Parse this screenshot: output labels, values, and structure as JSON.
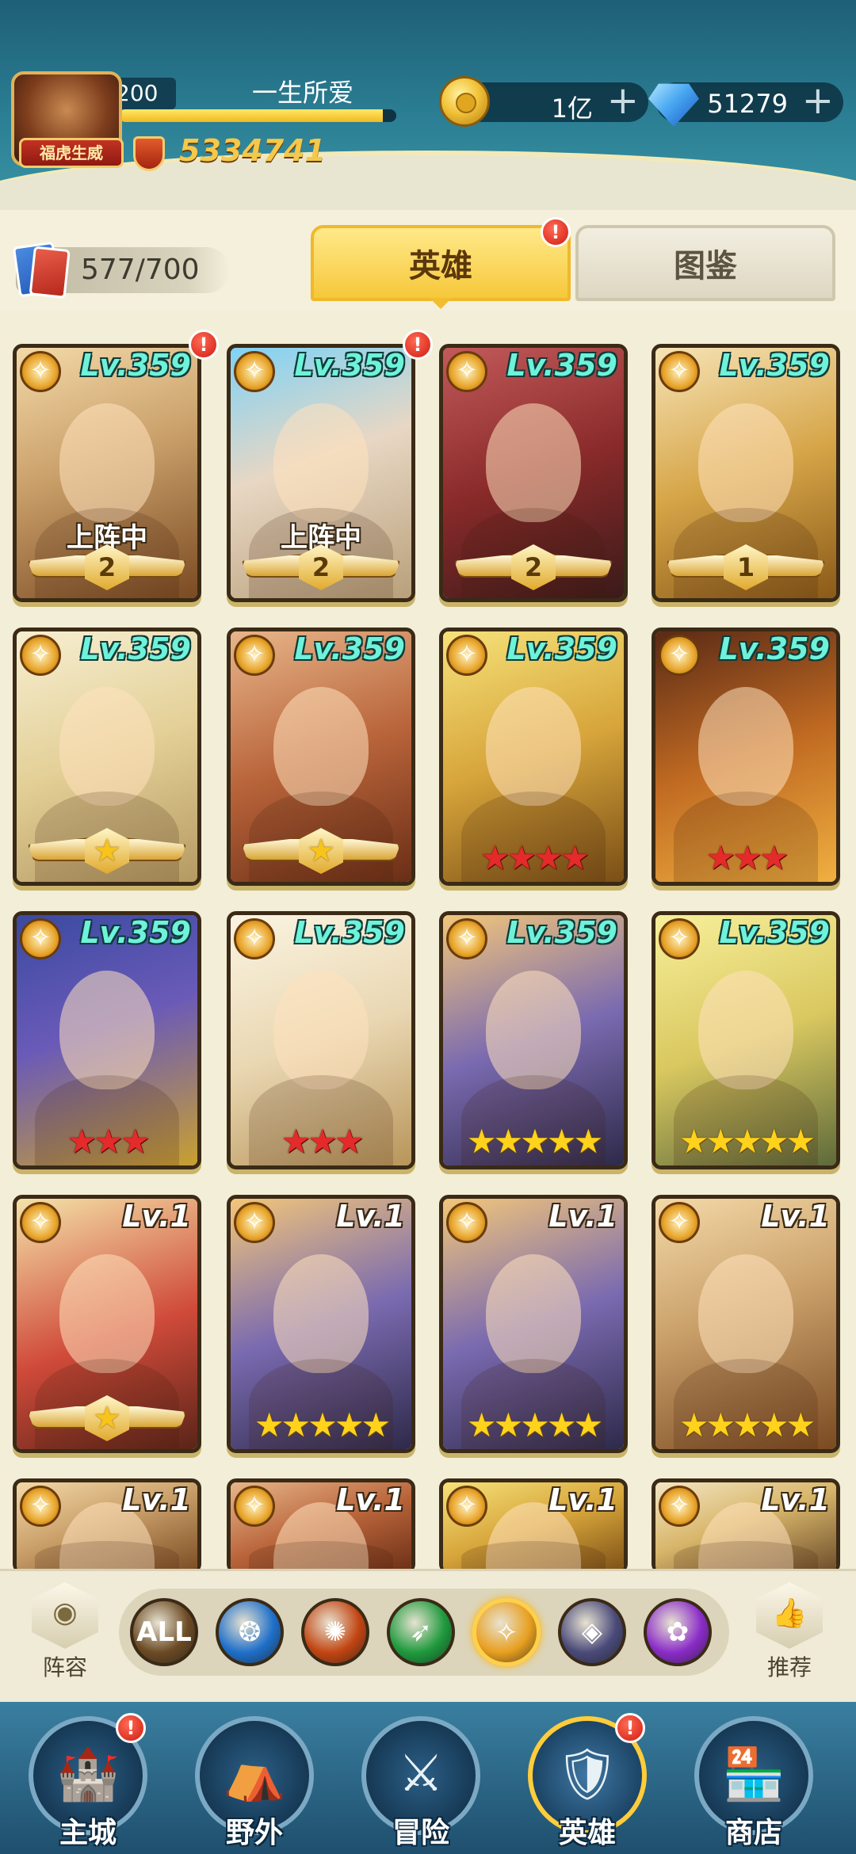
{
  "header": {
    "avatar_badge": "福虎生威",
    "player_level": "200",
    "player_name": "一生所爱",
    "xp_fraction": 0.95,
    "power": "5334741",
    "coins": "1亿",
    "gems": "51279",
    "plus_symbol": "+"
  },
  "collection": {
    "count": "577/700"
  },
  "tabs": [
    {
      "label": "英雄",
      "active": true
    },
    {
      "label": "图鉴",
      "active": false
    }
  ],
  "notification_mark": "!",
  "heroes": [
    {
      "level": "Lv.359",
      "theme": "twins-gold",
      "deployed": "上阵中",
      "rank": "2",
      "rank_type": "wing-number",
      "notify": true
    },
    {
      "level": "Lv.359",
      "theme": "blue-hair",
      "deployed": "上阵中",
      "rank": "2",
      "rank_type": "wing-number",
      "notify": true
    },
    {
      "level": "Lv.359",
      "theme": "red-hood",
      "deployed": "",
      "rank": "2",
      "rank_type": "wing-number",
      "notify": false
    },
    {
      "level": "Lv.359",
      "theme": "old-warrior",
      "deployed": "",
      "rank": "1",
      "rank_type": "wing-number",
      "notify": false
    },
    {
      "level": "Lv.359",
      "theme": "blonde-elf",
      "deployed": "",
      "rank": "★",
      "rank_type": "wing-star",
      "notify": false
    },
    {
      "level": "Lv.359",
      "theme": "monkey-king",
      "deployed": "",
      "rank": "★",
      "rank_type": "wing-star",
      "notify": false
    },
    {
      "level": "Lv.359",
      "theme": "yellow-girl",
      "deployed": "",
      "rank": "★★★★",
      "rank_type": "red-stars",
      "notify": false
    },
    {
      "level": "Lv.359",
      "theme": "fire-hair",
      "deployed": "",
      "rank": "★★★",
      "rank_type": "red-stars",
      "notify": false
    },
    {
      "level": "Lv.359",
      "theme": "blue-witch",
      "deployed": "",
      "rank": "★★★",
      "rank_type": "red-stars",
      "notify": false
    },
    {
      "level": "Lv.359",
      "theme": "white-sage",
      "deployed": "",
      "rank": "★★★",
      "rank_type": "red-stars",
      "notify": false
    },
    {
      "level": "Lv.359",
      "theme": "goggle-cat",
      "deployed": "",
      "rank": "★★★★★",
      "rank_type": "yellow-stars",
      "notify": false
    },
    {
      "level": "Lv.359",
      "theme": "green-blonde",
      "deployed": "",
      "rank": "★★★★★",
      "rank_type": "yellow-stars",
      "notify": false
    },
    {
      "level": "Lv.1",
      "theme": "red-knight",
      "deployed": "",
      "rank": "★",
      "rank_type": "wing-star",
      "notify": false
    },
    {
      "level": "Lv.1",
      "theme": "goggle-cat",
      "deployed": "",
      "rank": "★★★★★",
      "rank_type": "yellow-stars",
      "notify": false
    },
    {
      "level": "Lv.1",
      "theme": "goggle-cat",
      "deployed": "",
      "rank": "★★★★★",
      "rank_type": "yellow-stars",
      "notify": false
    },
    {
      "level": "Lv.1",
      "theme": "twins-gold",
      "deployed": "",
      "rank": "★★★★★",
      "rank_type": "yellow-stars",
      "notify": false
    },
    {
      "level": "Lv.1",
      "theme": "twins-gold",
      "deployed": "",
      "rank": "",
      "rank_type": "none",
      "notify": false
    },
    {
      "level": "Lv.1",
      "theme": "monkey-king",
      "deployed": "",
      "rank": "",
      "rank_type": "none",
      "notify": false
    },
    {
      "level": "Lv.1",
      "theme": "yellow-girl",
      "deployed": "",
      "rank": "",
      "rank_type": "none",
      "notify": false
    },
    {
      "level": "Lv.1",
      "theme": "dark-queen",
      "deployed": "",
      "rank": "",
      "rank_type": "none",
      "notify": false
    }
  ],
  "filter_bar": {
    "left_label": "阵容",
    "right_label": "推荐",
    "filters": [
      {
        "label": "ALL",
        "name": "all",
        "color": "#6b4a24"
      },
      {
        "label": "",
        "name": "water",
        "color": "#1f6fc9"
      },
      {
        "label": "",
        "name": "fire",
        "color": "#c24512"
      },
      {
        "label": "",
        "name": "wind",
        "color": "#1f9a3d"
      },
      {
        "label": "",
        "name": "light",
        "color": "#e8a020",
        "active": true
      },
      {
        "label": "",
        "name": "dark",
        "color": "#4a4a7a"
      },
      {
        "label": "",
        "name": "arcane",
        "color": "#8a2cc8"
      }
    ]
  },
  "bottom_nav": [
    {
      "label": "主城",
      "notify": true
    },
    {
      "label": "野外",
      "notify": false
    },
    {
      "label": "冒险",
      "notify": false
    },
    {
      "label": "英雄",
      "notify": true,
      "active": true
    },
    {
      "label": "商店",
      "notify": false
    }
  ]
}
